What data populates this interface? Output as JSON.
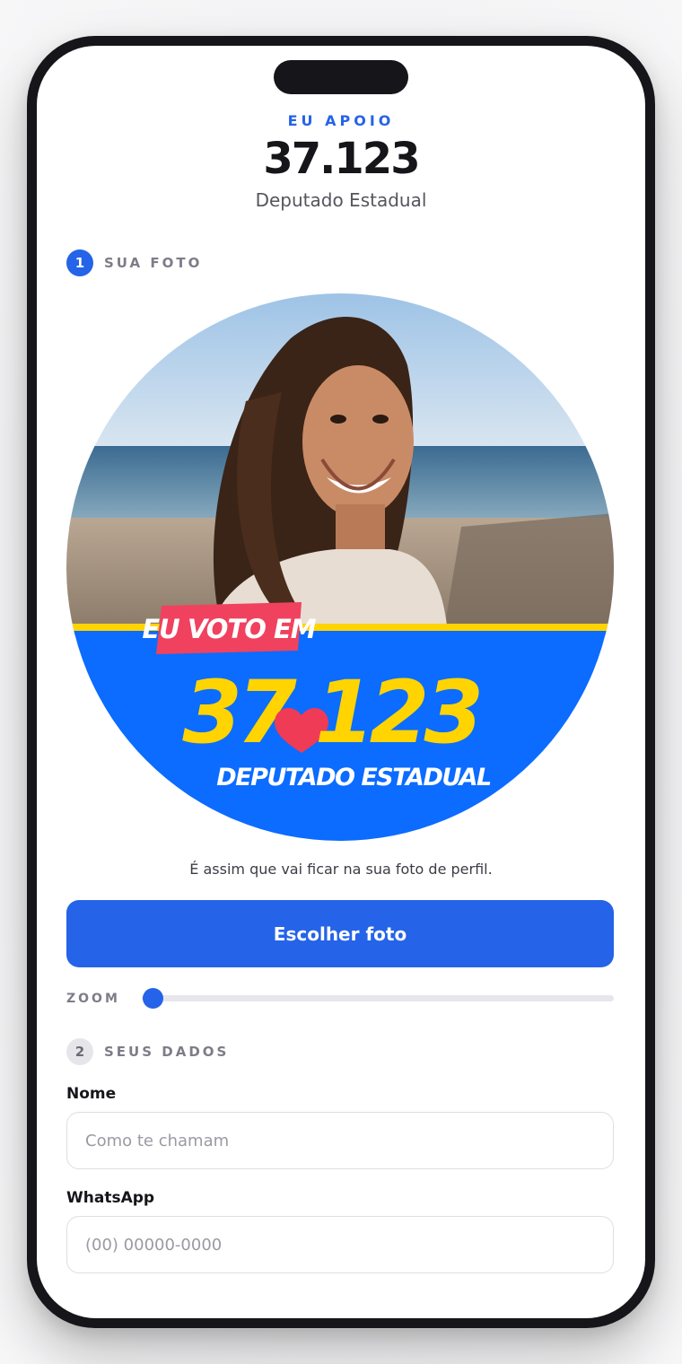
{
  "header": {
    "kicker": "EU APOIO",
    "number": "37.123",
    "role": "Deputado Estadual"
  },
  "step1": {
    "index": "1",
    "title": "SUA FOTO"
  },
  "preview": {
    "banner_tag": "EU VOTO EM",
    "banner_number_left": "37",
    "banner_number_right": "123",
    "banner_role": "DEPUTADO ESTADUAL",
    "caption": "É assim que vai ficar na sua foto de perfil."
  },
  "choose_photo_button": "Escolher foto",
  "zoom": {
    "label": "ZOOM",
    "value_fraction": 0.0
  },
  "step2": {
    "index": "2",
    "title": "SEUS DADOS"
  },
  "form": {
    "name_label": "Nome",
    "name_placeholder": "Como te chamam",
    "whatsapp_label": "WhatsApp",
    "whatsapp_placeholder": "(00) 00000-0000"
  },
  "colors": {
    "accent": "#2563e8",
    "banner_blue": "#0b6cff",
    "banner_yellow": "#ffd400",
    "tag_pink": "#f0425f",
    "heart_red": "#ef3b55"
  },
  "icons": {
    "heart": "heart-icon"
  }
}
